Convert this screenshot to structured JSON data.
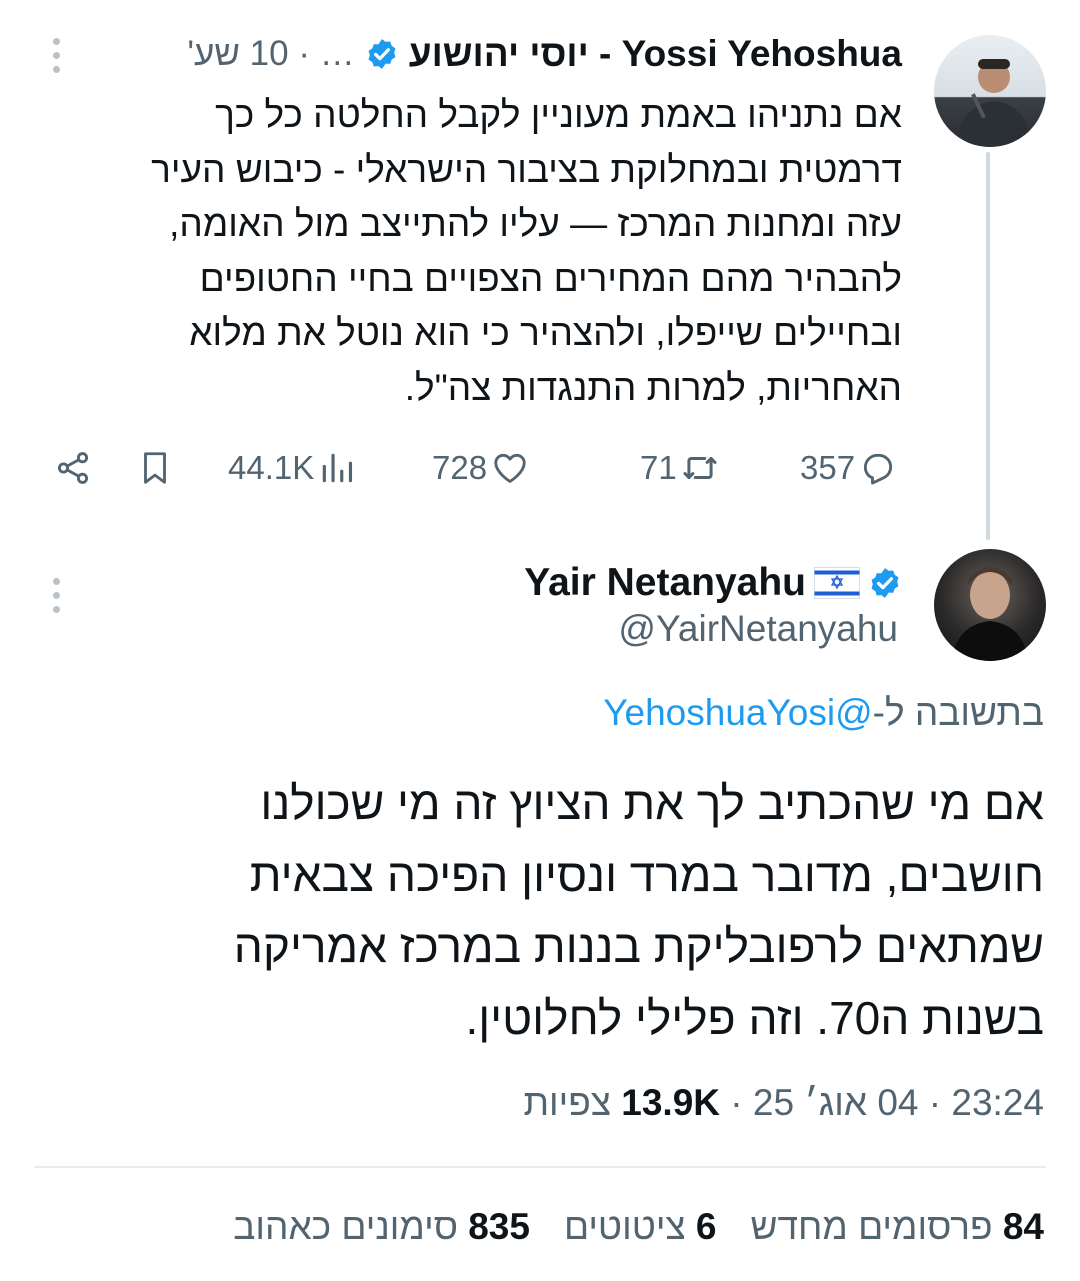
{
  "parent_tweet": {
    "author_name": "יוסי יהושוע - Yossi Yehoshua",
    "meta": "… · 10 שע'",
    "body_lines": [
      "אם נתניהו באמת מעוניין לקבל החלטה כל כך",
      "דרמטית ובמחלוקת  בציבור הישראלי - כיבוש העיר",
      "עזה ומחנות המרכז — עליו להתייצב מול האומה,",
      "להבהיר מהם המחירים הצפויים בחיי החטופים",
      "ובחיילים שייפלו, ולהצהיר כי הוא נוטל את מלוא",
      "האחריות, למרות התנגדות צה\"ל."
    ],
    "replies": "357",
    "retweets": "71",
    "likes": "728",
    "views": "44.1K"
  },
  "reply_tweet": {
    "author_name": "Yair Netanyahu",
    "handle": "@YairNetanyahu",
    "reply_prefix": "בתשובה ל-",
    "reply_mention": "@YehoshuaYosi",
    "body_lines": [
      "אם מי שהכתיב לך את הציוץ זה מי שכולנו",
      "חושבים, מדובר במרד ונסיון הפיכה צבאית",
      "שמתאים לרפובליקת בננות במרכז אמריקה",
      "בשנות ה70. וזה פלילי לחלוטין."
    ],
    "time_date": "23:24 · 04 אוג׳ 25 · ",
    "views_count": "13.9K",
    "views_label": " צפיות",
    "stats": {
      "reposts_count": "84",
      "reposts_label": " פרסומים מחדש",
      "quotes_count": "6",
      "quotes_label": " ציטוטים",
      "likes_count": "835",
      "likes_label": " סימונים כאהוב"
    }
  },
  "colors": {
    "text_primary": "#0f1419",
    "text_secondary": "#536471",
    "accent": "#1d9bf0",
    "verified": "#1d9bf0",
    "thread_line": "#cfd9de"
  }
}
